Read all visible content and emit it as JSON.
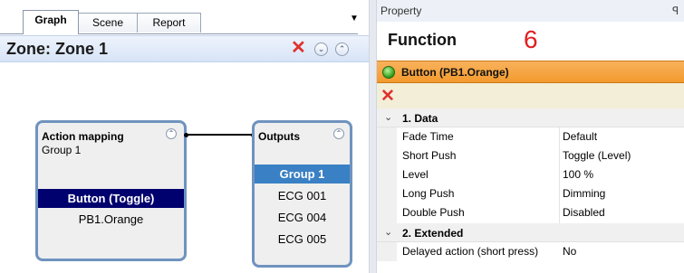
{
  "tabs": [
    {
      "label": "Graph",
      "active": true
    },
    {
      "label": "Scene",
      "active": false
    },
    {
      "label": "Report",
      "active": false
    }
  ],
  "zone": {
    "title": "Zone: Zone 1"
  },
  "graph": {
    "action_node": {
      "title": "Action mapping",
      "subtitle": "Group 1",
      "rows": [
        "Button (Toggle)",
        "PB1.Orange"
      ]
    },
    "outputs_node": {
      "title": "Outputs",
      "rows": [
        "Group 1",
        "ECG 001",
        "ECG 004",
        "ECG 005"
      ]
    }
  },
  "property": {
    "caption": "Property",
    "function_title": "Function",
    "marker": "6",
    "button_title": "Button (PB1.Orange)",
    "categories": [
      {
        "label": "1. Data",
        "rows": [
          {
            "name": "Fade Time",
            "value": "Default"
          },
          {
            "name": "Short Push",
            "value": "Toggle (Level)"
          },
          {
            "name": "Level",
            "value": "100 %"
          },
          {
            "name": "Long Push",
            "value": "Dimming"
          },
          {
            "name": "Double Push",
            "value": "Disabled"
          }
        ]
      },
      {
        "label": "2. Extended",
        "rows": [
          {
            "name": "Delayed action (short press)",
            "value": "No"
          }
        ]
      }
    ]
  },
  "icons": {
    "close": "close-icon",
    "collapse": "chevron-double-up-icon",
    "expand": "chevron-double-down-icon",
    "pin": "pin-icon",
    "status": "green-status-icon",
    "delete": "delete-icon"
  },
  "colors": {
    "header_blue": "#d7e4f6",
    "node_border": "#6f93bf",
    "selected_row": "#00006e",
    "selected_output": "#3a80c4",
    "orange_bar": "#f39a2e",
    "close_red": "#e0312f"
  }
}
